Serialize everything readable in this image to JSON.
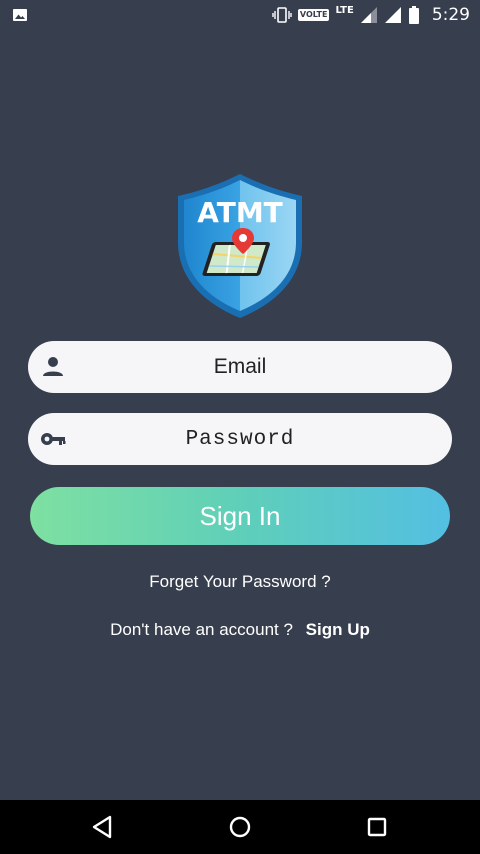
{
  "status_bar": {
    "volte": "VOLTE",
    "network": "LTE",
    "time": "5:29"
  },
  "logo": {
    "text": "ATMT"
  },
  "form": {
    "email_placeholder": "Email",
    "password_placeholder": "Password",
    "signin_label": "Sign In",
    "forgot_label": "Forget Your Password ?",
    "no_account_label": "Don't have an account ?",
    "signup_label": "Sign Up"
  },
  "colors": {
    "background": "#373e4e",
    "gradient_start": "#7ee0a1",
    "gradient_end": "#54bfe2",
    "shield_blue": "#2f97d9"
  }
}
